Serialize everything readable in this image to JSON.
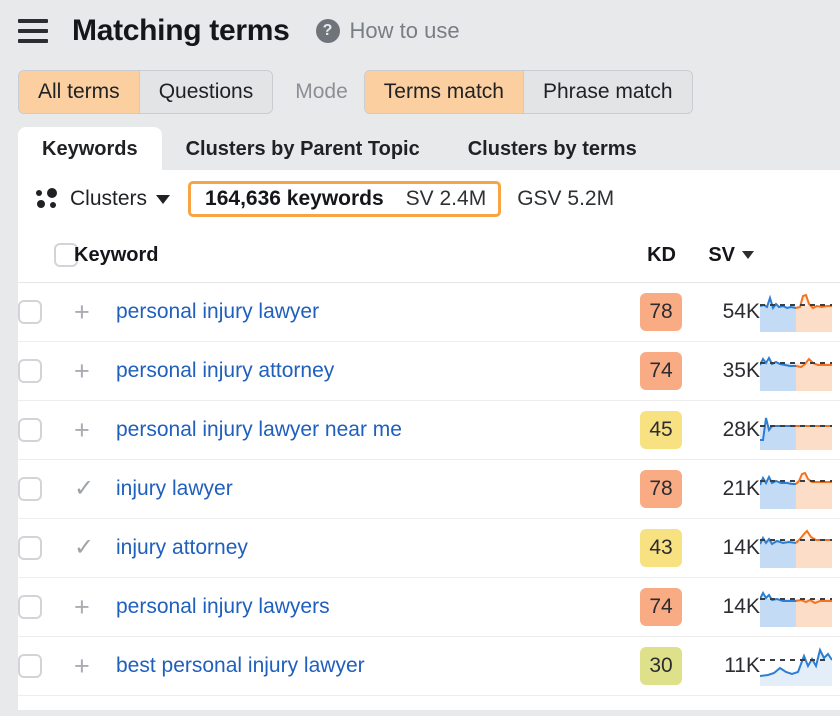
{
  "header": {
    "menu_icon": "hamburger-menu-icon",
    "title": "Matching terms",
    "help_icon": "question-mark-circle-icon",
    "help_label": "How to use"
  },
  "filters": {
    "terms_group": [
      {
        "label": "All terms",
        "active": true
      },
      {
        "label": "Questions",
        "active": false
      }
    ],
    "mode_label": "Mode",
    "mode_group": [
      {
        "label": "Terms match",
        "active": true
      },
      {
        "label": "Phrase match",
        "active": false
      }
    ]
  },
  "tabs": [
    {
      "label": "Keywords",
      "active": true
    },
    {
      "label": "Clusters by Parent Topic",
      "active": false
    },
    {
      "label": "Clusters by terms",
      "active": false
    }
  ],
  "summary": {
    "clusters_icon": "clusters-dots-icon",
    "clusters_label": "Clusters",
    "clusters_caret": "chevron-down-icon",
    "keywords_count": "164,636 keywords",
    "sv_total": "SV 2.4M",
    "gsv_total": "GSV 5.2M",
    "highlight_color": "#f8a444"
  },
  "table": {
    "columns": {
      "keyword": "Keyword",
      "kd": "KD",
      "sv": "SV"
    },
    "sort_icon": "sort-descending-caret-icon",
    "rows": [
      {
        "keyword": "personal injury lawyer",
        "action_icon": "plus-icon",
        "action_glyph": "+",
        "kd": "78",
        "kd_color": "#f9ab84",
        "sv": "54K",
        "spark_type": "blue-orange"
      },
      {
        "keyword": "personal injury attorney",
        "action_icon": "plus-icon",
        "action_glyph": "+",
        "kd": "74",
        "kd_color": "#f9ab84",
        "sv": "35K",
        "spark_type": "blue-orange"
      },
      {
        "keyword": "personal injury lawyer near me",
        "action_icon": "plus-icon",
        "action_glyph": "+",
        "kd": "45",
        "kd_color": "#f8e181",
        "sv": "28K",
        "spark_type": "blue-orange-flat"
      },
      {
        "keyword": "injury lawyer",
        "action_icon": "check-icon",
        "action_glyph": "✓",
        "kd": "78",
        "kd_color": "#f9ab84",
        "sv": "21K",
        "spark_type": "blue-orange"
      },
      {
        "keyword": "injury attorney",
        "action_icon": "check-icon",
        "action_glyph": "✓",
        "kd": "43",
        "kd_color": "#f8e181",
        "sv": "14K",
        "spark_type": "blue-orange"
      },
      {
        "keyword": "personal injury lawyers",
        "action_icon": "plus-icon",
        "action_glyph": "+",
        "kd": "74",
        "kd_color": "#f9ab84",
        "sv": "14K",
        "spark_type": "blue-orange"
      },
      {
        "keyword": "best personal injury lawyer",
        "action_icon": "plus-icon",
        "action_glyph": "+",
        "kd": "30",
        "kd_color": "#dfe08a",
        "sv": "11K",
        "spark_type": "blue-only"
      }
    ]
  },
  "colors": {
    "accent_orange": "#f8a444",
    "segment_active": "#fbcfa0",
    "link_blue": "#1f5fbd",
    "spark_blue": "#2b7fd4",
    "spark_orange": "#f37321",
    "page_bg": "#e8e9eb"
  }
}
